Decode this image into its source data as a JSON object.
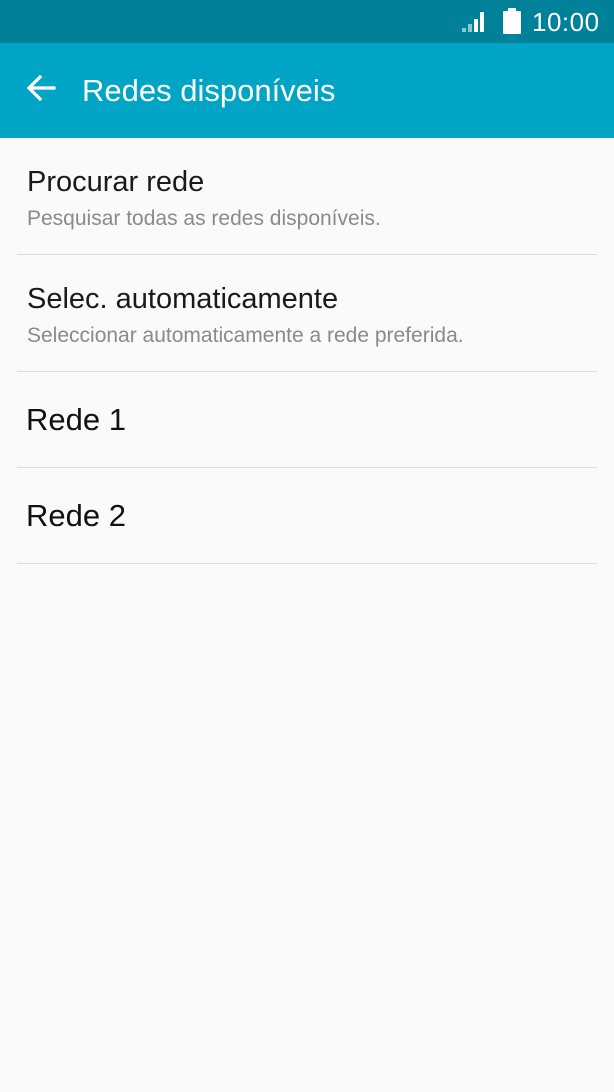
{
  "status_bar": {
    "time": "10:00",
    "icons": [
      "signal-icon",
      "battery-icon"
    ],
    "color": "#00819a"
  },
  "app_bar": {
    "title": "Redes disponíveis",
    "back_icon": "arrow-back-icon",
    "color": "#00a5c5"
  },
  "list": {
    "items": [
      {
        "title": "Procurar rede",
        "subtitle": "Pesquisar todas as redes disponíveis."
      },
      {
        "title": "Selec. automaticamente",
        "subtitle": "Seleccionar automaticamente a rede preferida."
      },
      {
        "title": "Rede 1"
      },
      {
        "title": "Rede 2"
      }
    ]
  }
}
